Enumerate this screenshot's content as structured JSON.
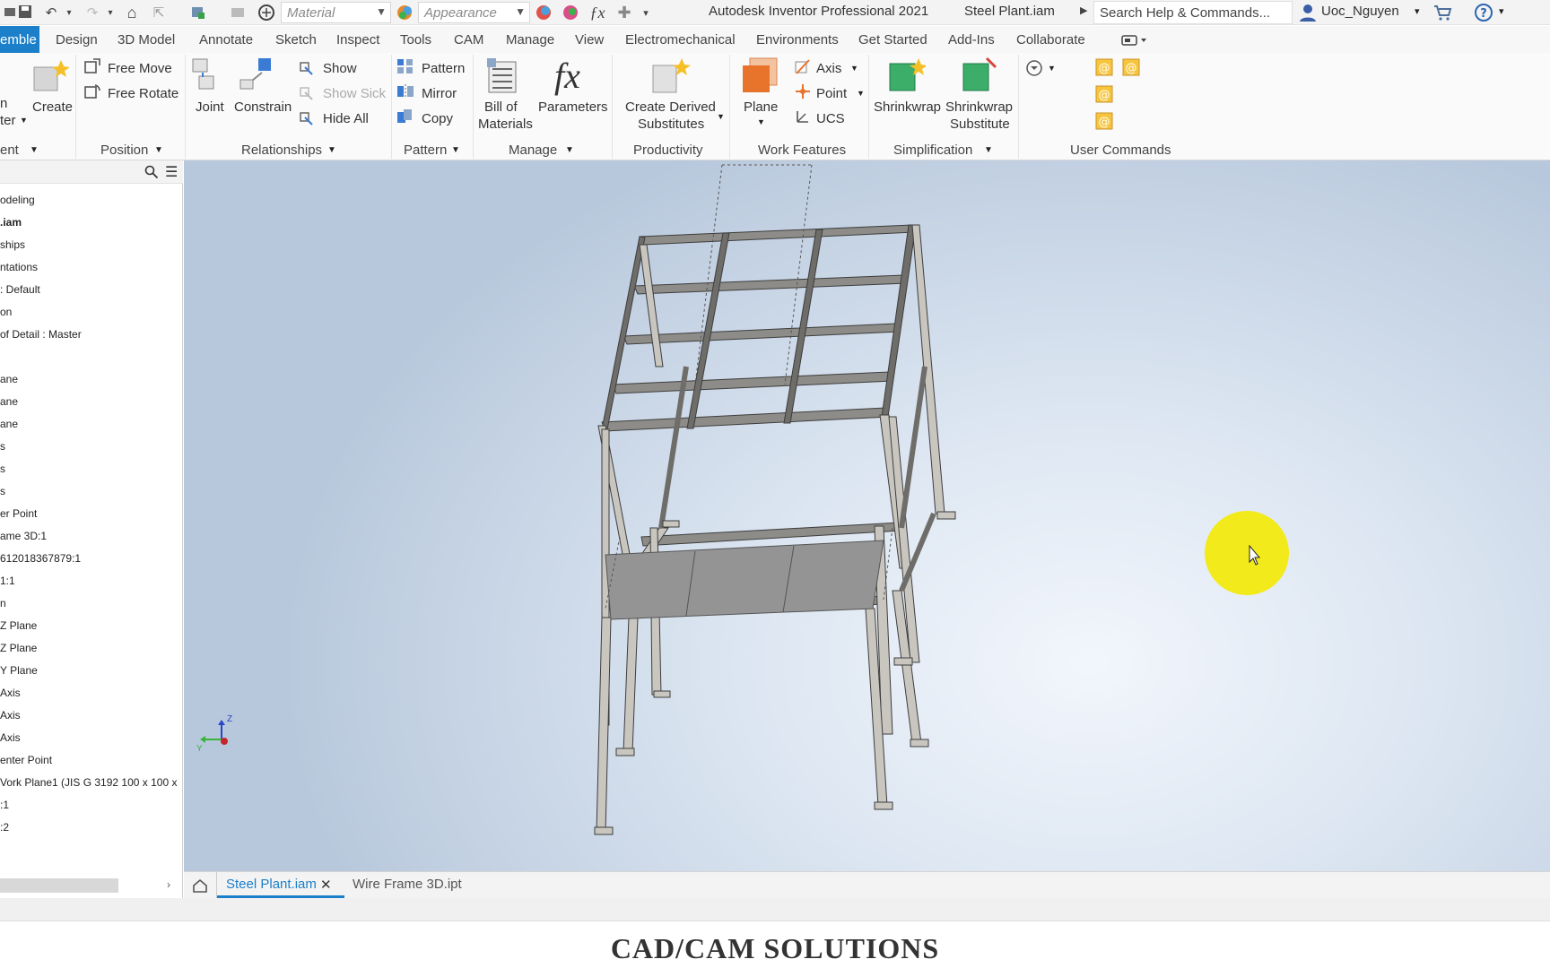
{
  "window": {
    "app_title": "Autodesk Inventor Professional 2021",
    "document_title": "Steel Plant.iam",
    "search_placeholder": "Search Help & Commands...",
    "user": "Uoc_Nguyen",
    "material_dropdown": "Material",
    "appearance_dropdown": "Appearance"
  },
  "ribbon_tabs": [
    "emble",
    "Design",
    "3D Model",
    "Annotate",
    "Sketch",
    "Inspect",
    "Tools",
    "CAM",
    "Manage",
    "View",
    "Electromechanical",
    "Environments",
    "Get Started",
    "Add-Ins",
    "Collaborate"
  ],
  "ribbon": {
    "component": {
      "create_label": "Create",
      "partial_place": "n",
      "partial_center": "ter",
      "group": "ent"
    },
    "position": {
      "free_move": "Free Move",
      "free_rotate": "Free Rotate",
      "group": "Position"
    },
    "relationships": {
      "joint": "Joint",
      "constrain": "Constrain",
      "show": "Show",
      "show_sick": "Show Sick",
      "hide_all": "Hide All",
      "group": "Relationships"
    },
    "pattern": {
      "pattern": "Pattern",
      "mirror": "Mirror",
      "copy": "Copy",
      "group": "Pattern"
    },
    "manage": {
      "bom_line1": "Bill of",
      "bom_line2": "Materials",
      "parameters": "Parameters",
      "fx": "fx",
      "group": "Manage"
    },
    "productivity": {
      "line1": "Create Derived",
      "line2": "Substitutes",
      "group": "Productivity"
    },
    "work_features": {
      "plane": "Plane",
      "axis": "Axis",
      "point": "Point",
      "ucs": "UCS",
      "group": "Work Features"
    },
    "simplification": {
      "shrinkwrap": "Shrinkwrap",
      "sws_line1": "Shrinkwrap",
      "sws_line2": "Substitute",
      "group": "Simplification"
    },
    "user_commands": {
      "group": "User Commands"
    }
  },
  "browser_tree": [
    "odeling",
    ".iam",
    "ships",
    "ntations",
    ": Default",
    "on",
    " of Detail : Master",
    "",
    "ane",
    "ane",
    "ane",
    "s",
    "s",
    "s",
    "er Point",
    "ame 3D:1",
    "612018367879:1",
    " 1:1",
    "n",
    "Z Plane",
    "Z Plane",
    "Y Plane",
    " Axis",
    " Axis",
    " Axis",
    "enter Point",
    "Vork Plane1 (JIS G 3192 100 x 100 x",
    ":1",
    ":2"
  ],
  "doc_tabs": {
    "active": "Steel Plant.iam",
    "other": "Wire Frame 3D.ipt"
  },
  "viewcube_axes": {
    "z": "Z",
    "y": "Y"
  },
  "footer": "CAD/CAM SOLUTIONS",
  "colors": {
    "accent": "#1b7fc9",
    "highlight_cursor": "#f2ea1a",
    "steel": "#a9a6a0"
  }
}
